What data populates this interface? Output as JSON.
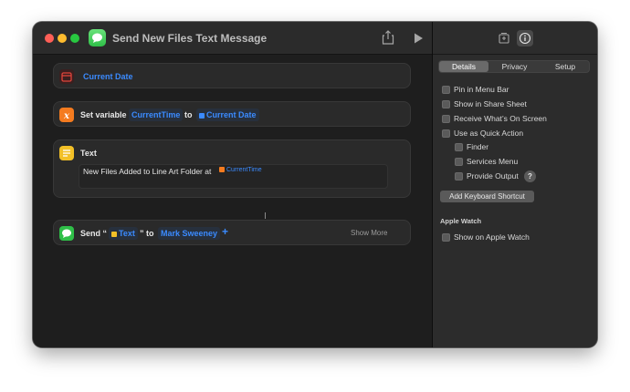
{
  "window": {
    "title": "Send New Files Text Message"
  },
  "actions": {
    "date": {
      "token": "Current Date"
    },
    "set_variable": {
      "label": "Set variable",
      "variable": "CurrentTime",
      "to_label": "to",
      "value": "Current Date"
    },
    "text": {
      "label": "Text",
      "body": "New Files Added to Line Art Folder at",
      "variable": "CurrentTime"
    },
    "send": {
      "label": "Send “",
      "token": "Text",
      "to_label": "” to",
      "recipient": "Mark Sweeney",
      "add": "+",
      "show_more": "Show More"
    }
  },
  "panel": {
    "tabs": [
      "Details",
      "Privacy",
      "Setup"
    ],
    "active_tab": "Details",
    "options": [
      {
        "label": "Pin in Menu Bar",
        "checked": false
      },
      {
        "label": "Show in Share Sheet",
        "checked": false
      },
      {
        "label": "Receive What’s On Screen",
        "checked": false
      },
      {
        "label": "Use as Quick Action",
        "checked": false
      }
    ],
    "quick_action_sub": [
      {
        "label": "Finder",
        "checked": false
      },
      {
        "label": "Services Menu",
        "checked": false
      },
      {
        "label": "Provide Output",
        "checked": false
      }
    ],
    "help": "?",
    "keyboard_button": "Add Keyboard Shortcut",
    "apple_watch_title": "Apple Watch",
    "apple_watch_option": {
      "label": "Show on Apple Watch",
      "checked": false
    }
  },
  "colors": {
    "accent_blue": "#3b8bff",
    "messages_green": "#2fbf48",
    "calendar_red": "#e0443b",
    "variable_orange": "#f47b1f",
    "text_yellow": "#f2c027"
  },
  "icons": [
    "messages-icon",
    "share-icon",
    "play-icon",
    "library-icon",
    "info-icon",
    "calendar-icon",
    "variable-icon",
    "text-icon"
  ]
}
